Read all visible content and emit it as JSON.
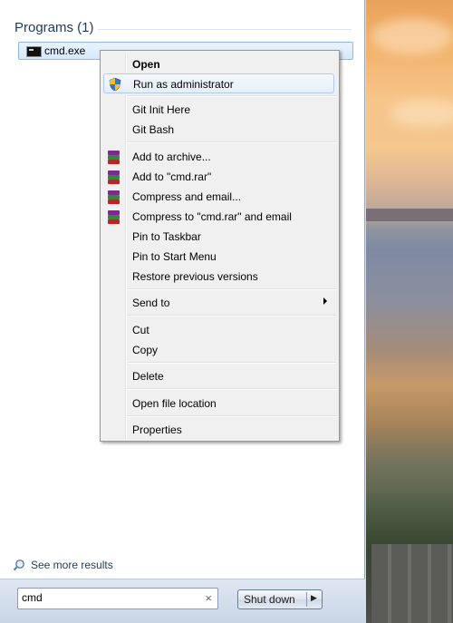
{
  "start_menu": {
    "group_header": "Programs (1)",
    "result": {
      "label": "cmd.exe",
      "icon": "console-icon"
    },
    "see_more": "See more results",
    "search": {
      "value": "cmd",
      "clear_glyph": "×"
    },
    "shutdown": {
      "label": "Shut down",
      "arrow": "▶"
    }
  },
  "context_menu": {
    "items": [
      {
        "label": "Open",
        "bold": true
      },
      {
        "label": "Run as administrator",
        "icon": "uac-shield-icon",
        "highlighted": true
      },
      {
        "label": "Git Init Here"
      },
      {
        "label": "Git Bash"
      },
      {
        "label": "Add to archive...",
        "icon": "winrar-icon"
      },
      {
        "label": "Add to \"cmd.rar\"",
        "icon": "winrar-icon"
      },
      {
        "label": "Compress and email...",
        "icon": "winrar-icon"
      },
      {
        "label": "Compress to \"cmd.rar\" and email",
        "icon": "winrar-icon"
      },
      {
        "label": "Pin to Taskbar"
      },
      {
        "label": "Pin to Start Menu"
      },
      {
        "label": "Restore previous versions"
      },
      {
        "label": "Send to",
        "submenu": true
      },
      {
        "label": "Cut"
      },
      {
        "label": "Copy"
      },
      {
        "label": "Delete"
      },
      {
        "label": "Open file location"
      },
      {
        "label": "Properties"
      }
    ]
  },
  "colors": {
    "header_text": "#1e395b",
    "highlight_border": "#aeccf0",
    "menu_background": "#f0f0f0"
  }
}
